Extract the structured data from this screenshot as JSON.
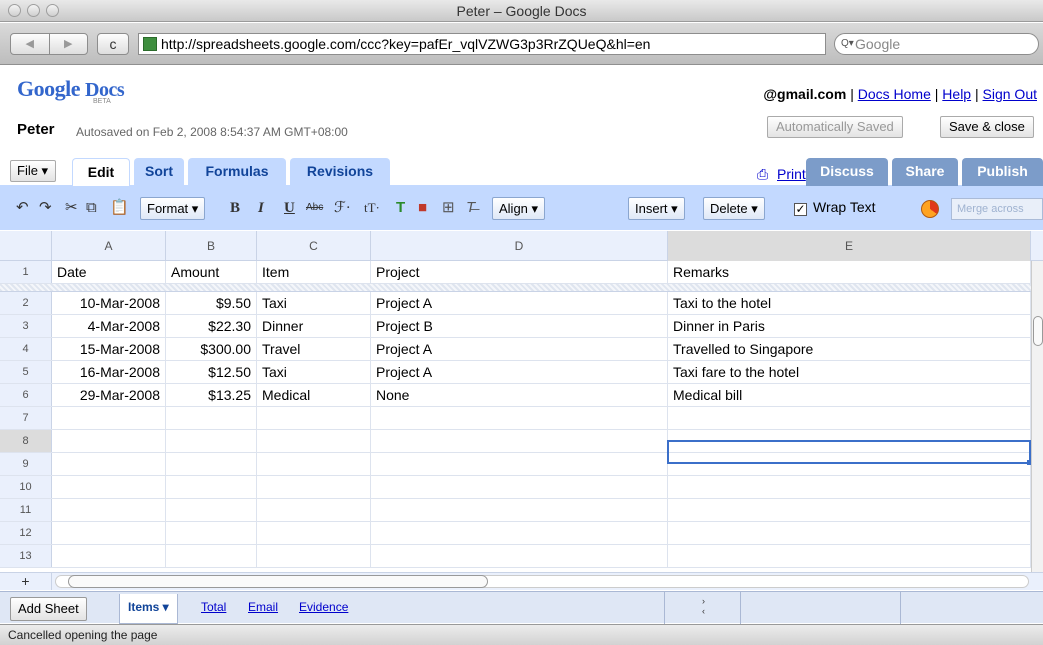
{
  "window": {
    "title": "Peter – Google Docs"
  },
  "browser": {
    "url": "http://spreadsheets.google.com/ccc?key=pafEr_vqlVZWG3p3RrZQUeQ&hl=en",
    "search_placeholder": "Google",
    "back": "◀",
    "forward": "▶",
    "reload": "c"
  },
  "header": {
    "logo_main": "Google",
    "logo_docs": "Docs",
    "beta": "BETA",
    "account": "@gmail.com",
    "sep": "|",
    "links": [
      "Docs Home",
      "Help",
      "Sign Out"
    ],
    "doc_title": "Peter",
    "autosave": "Autosaved on Feb 2, 2008 8:54:37 AM GMT+08:00",
    "auto_saved_btn": "Automatically Saved",
    "save_close_btn": "Save & close"
  },
  "tabs": {
    "file": "File ▾",
    "items": [
      "Edit",
      "Sort",
      "Formulas",
      "Revisions"
    ],
    "print": "Print",
    "right": [
      "Discuss",
      "Share",
      "Publish"
    ]
  },
  "format_toolbar": {
    "format": "Format ▾",
    "bold": "B",
    "italic": "I",
    "underline": "U",
    "strike": "Abc",
    "font": "ℱ·",
    "size": "tT·",
    "align": "Align ▾",
    "insert": "Insert ▾",
    "delete": "Delete ▾",
    "wrap_text": "Wrap Text",
    "wrap_checked": "✓",
    "merge": "Merge across"
  },
  "sheet": {
    "columns": [
      "A",
      "B",
      "C",
      "D",
      "E"
    ],
    "header_row": {
      "num": "1",
      "cells": [
        "Date",
        "Amount",
        "Item",
        "Project",
        "Remarks"
      ]
    },
    "rows": [
      {
        "num": "2",
        "cells": [
          "10-Mar-2008",
          "$9.50",
          "Taxi",
          "Project A",
          "Taxi to the hotel"
        ]
      },
      {
        "num": "3",
        "cells": [
          "4-Mar-2008",
          "$22.30",
          "Dinner",
          "Project B",
          "Dinner in Paris"
        ]
      },
      {
        "num": "4",
        "cells": [
          "15-Mar-2008",
          "$300.00",
          "Travel",
          "Project A",
          "Travelled to Singapore"
        ]
      },
      {
        "num": "5",
        "cells": [
          "16-Mar-2008",
          "$12.50",
          "Taxi",
          "Project A",
          "Taxi fare to the hotel"
        ]
      },
      {
        "num": "6",
        "cells": [
          "29-Mar-2008",
          "$13.25",
          "Medical",
          "None",
          "Medical bill"
        ]
      },
      {
        "num": "7",
        "cells": [
          "",
          "",
          "",
          "",
          ""
        ]
      },
      {
        "num": "8",
        "cells": [
          "",
          "",
          "",
          "",
          ""
        ]
      },
      {
        "num": "9",
        "cells": [
          "",
          "",
          "",
          "",
          ""
        ]
      },
      {
        "num": "10",
        "cells": [
          "",
          "",
          "",
          "",
          ""
        ]
      },
      {
        "num": "11",
        "cells": [
          "",
          "",
          "",
          "",
          ""
        ]
      },
      {
        "num": "12",
        "cells": [
          "",
          "",
          "",
          "",
          ""
        ]
      },
      {
        "num": "13",
        "cells": [
          "",
          "",
          "",
          "",
          ""
        ]
      }
    ],
    "add_row": "+"
  },
  "sheet_tabs": {
    "add_sheet": "Add Sheet",
    "active": "Items ▾",
    "others": [
      "Total",
      "Email",
      "Evidence"
    ]
  },
  "status": "Cancelled opening the page",
  "colors": {
    "accent": "#c3d9ff",
    "link": "#0000cc",
    "share_tab": "#7c9cc9"
  }
}
